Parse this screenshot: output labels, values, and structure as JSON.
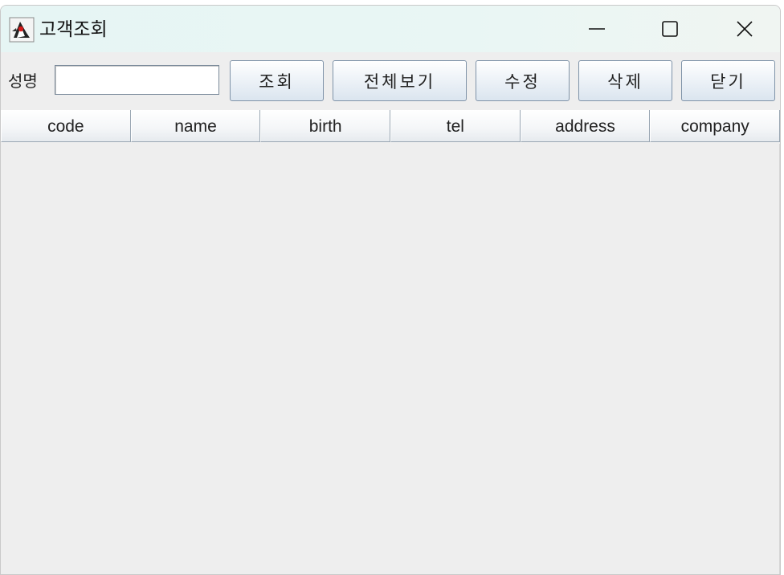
{
  "window": {
    "title": "고객조회",
    "icon": "java-duke-icon"
  },
  "controls": {
    "minimize": "minimize-icon",
    "maximize": "maximize-icon",
    "close": "close-icon"
  },
  "search": {
    "label": "성명",
    "value": "",
    "placeholder": ""
  },
  "buttons": {
    "search": "조회",
    "view_all": "전체보기",
    "edit": "수정",
    "delete": "삭제",
    "close": "닫기"
  },
  "table": {
    "columns": [
      "code",
      "name",
      "birth",
      "tel",
      "address",
      "company"
    ],
    "rows": []
  }
}
